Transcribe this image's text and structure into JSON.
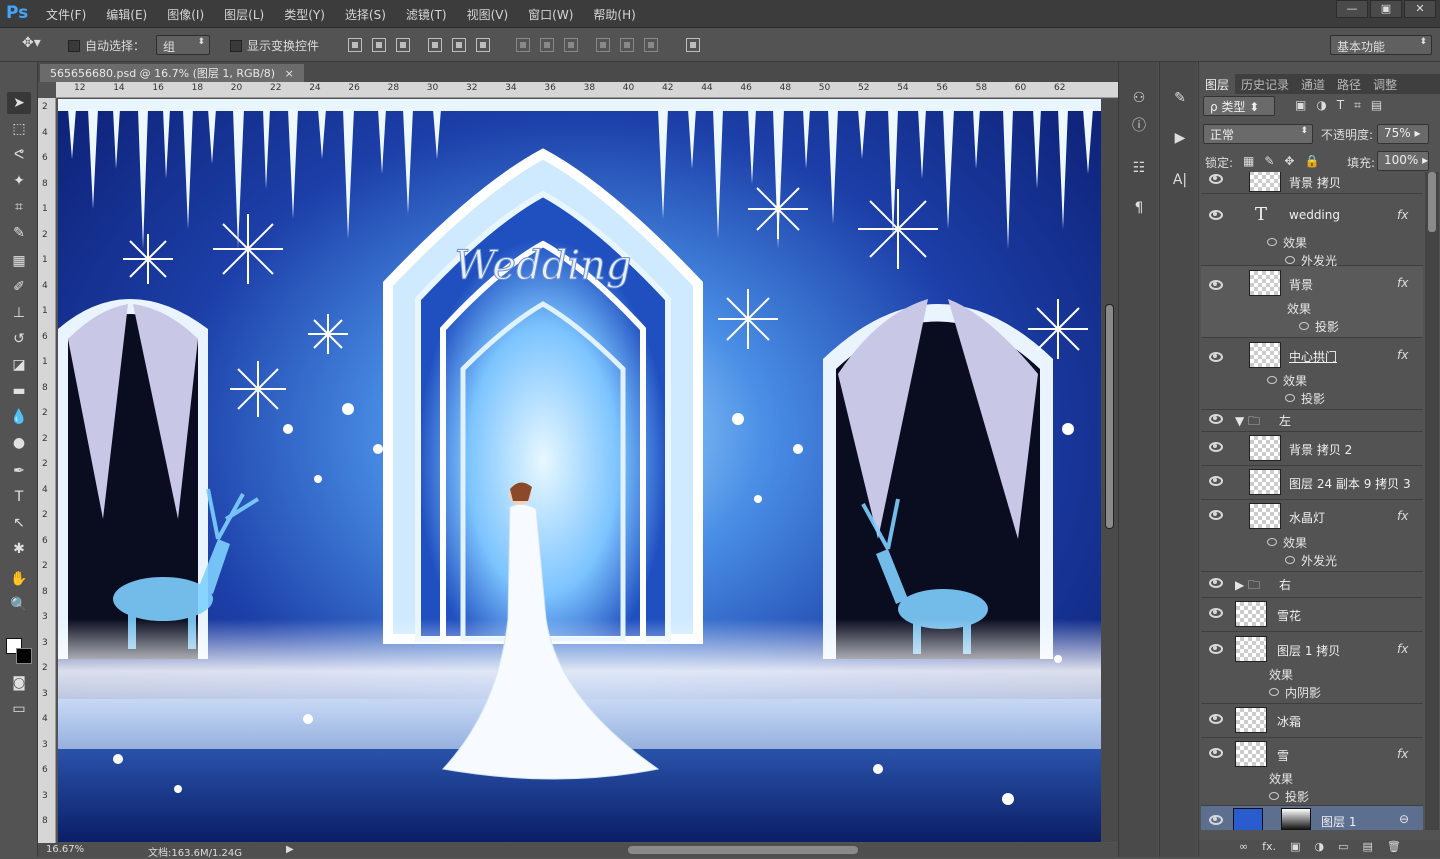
{
  "app": {
    "logo": "Ps",
    "menus": [
      "文件(F)",
      "编辑(E)",
      "图像(I)",
      "图层(L)",
      "类型(Y)",
      "选择(S)",
      "滤镜(T)",
      "视图(V)",
      "窗口(W)",
      "帮助(H)"
    ],
    "window_buttons": [
      "—",
      "▣",
      "✕"
    ]
  },
  "options": {
    "auto_select_label": "自动选择：",
    "auto_select_value": "组",
    "show_transform_label": "显示变换控件",
    "workspace": "基本功能"
  },
  "document": {
    "tab_title": "565656680.psd @ 16.7% (图层 1, RGB/8)",
    "tab_close": "×",
    "zoom": "16.67%",
    "doc_info": "文档:163.6M/1.24G"
  },
  "ruler": {
    "h_ticks": [
      "12",
      "14",
      "16",
      "18",
      "20",
      "22",
      "24",
      "26",
      "28",
      "30",
      "32",
      "34",
      "36",
      "38",
      "40",
      "42",
      "44",
      "46",
      "48",
      "50",
      "52",
      "54",
      "56",
      "58",
      "60",
      "62"
    ],
    "v_ticks": [
      "2",
      "4",
      "6",
      "8",
      "1",
      "2",
      "1",
      "4",
      "1",
      "6",
      "1",
      "8",
      "2",
      "2",
      "2",
      "4",
      "2",
      "6",
      "2",
      "8",
      "3",
      "3",
      "2",
      "3",
      "4",
      "3",
      "6",
      "3",
      "8"
    ]
  },
  "canvas": {
    "sign_text": "Wedding"
  },
  "panel": {
    "tabs": [
      "图层",
      "历史记录",
      "通道",
      "路径",
      "调整"
    ],
    "filter_label": "ρ 类型",
    "blend_mode": "正常",
    "opacity_label": "不透明度:",
    "opacity_value": "75%",
    "lock_label": "锁定:",
    "fill_label": "填充:",
    "fill_value": "100%",
    "layers": [
      {
        "name": "背景 拷贝",
        "fx": ""
      },
      {
        "name": "wedding",
        "fx": "fx",
        "text": "T"
      },
      {
        "name": "效果",
        "fx": ""
      },
      {
        "name": "外发光",
        "fx": ""
      },
      {
        "name": "背景",
        "fx": "fx"
      },
      {
        "name": "效果",
        "fx": ""
      },
      {
        "name": "投影",
        "fx": ""
      },
      {
        "name": "中心拱门",
        "fx": "fx"
      },
      {
        "name": "效果",
        "fx": ""
      },
      {
        "name": "投影",
        "fx": ""
      },
      {
        "name": "左",
        "fx": ""
      },
      {
        "name": "背景 拷贝 2",
        "fx": ""
      },
      {
        "name": "图层 24 副本 9 拷贝 3",
        "fx": ""
      },
      {
        "name": "水晶灯",
        "fx": "fx"
      },
      {
        "name": "效果",
        "fx": ""
      },
      {
        "name": "外发光",
        "fx": ""
      },
      {
        "name": "右",
        "fx": ""
      },
      {
        "name": "雪花",
        "fx": ""
      },
      {
        "name": "图层 1 拷贝",
        "fx": "fx"
      },
      {
        "name": "效果",
        "fx": ""
      },
      {
        "name": "内阴影",
        "fx": ""
      },
      {
        "name": "冰霜",
        "fx": ""
      },
      {
        "name": "雪",
        "fx": "fx"
      },
      {
        "name": "效果",
        "fx": ""
      },
      {
        "name": "投影",
        "fx": ""
      },
      {
        "name": "图层 1",
        "fx": ""
      }
    ],
    "bottom_icons": [
      "∞",
      "fx.",
      "▣",
      "◑",
      "▭",
      "▤",
      "🗑"
    ]
  }
}
